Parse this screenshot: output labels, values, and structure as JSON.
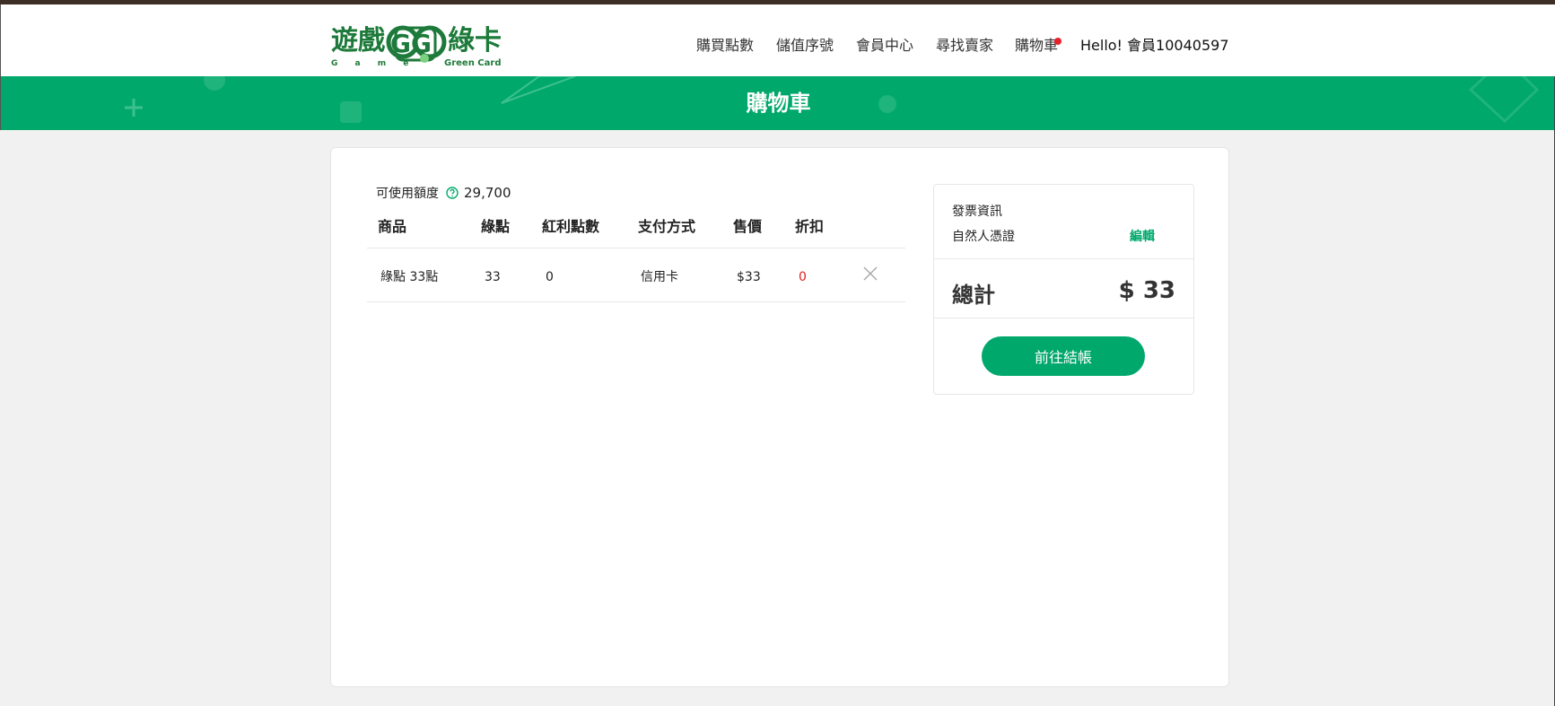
{
  "header": {
    "logo_text": "遊戲GG綠卡",
    "logo_sub_left": "G a m e",
    "logo_sub_right": "Green Card",
    "nav": [
      {
        "label": "購買點數"
      },
      {
        "label": "儲值序號"
      },
      {
        "label": "會員中心"
      },
      {
        "label": "尋找賣家"
      },
      {
        "label": "購物車"
      }
    ],
    "greeting": "Hello! 會員10040597"
  },
  "banner": {
    "title": "購物車"
  },
  "cart": {
    "credit_label": "可使用額度",
    "credit_value": "29,700",
    "columns": [
      "商品",
      "綠點",
      "紅利點數",
      "支付方式",
      "售價",
      "折扣"
    ],
    "rows": [
      {
        "product": "綠點 33點",
        "points": "33",
        "bonus": "0",
        "payment": "信用卡",
        "price": "$33",
        "discount": "0"
      }
    ]
  },
  "summary": {
    "invoice_title": "發票資訊",
    "invoice_type": "自然人憑證",
    "edit_label": "編輯",
    "total_label": "總計",
    "total_value": "$ 33",
    "checkout_label": "前往結帳"
  },
  "colors": {
    "brand_green": "#00a86b",
    "alert_red": "#e02020",
    "top_strip": "#3d2f25"
  }
}
